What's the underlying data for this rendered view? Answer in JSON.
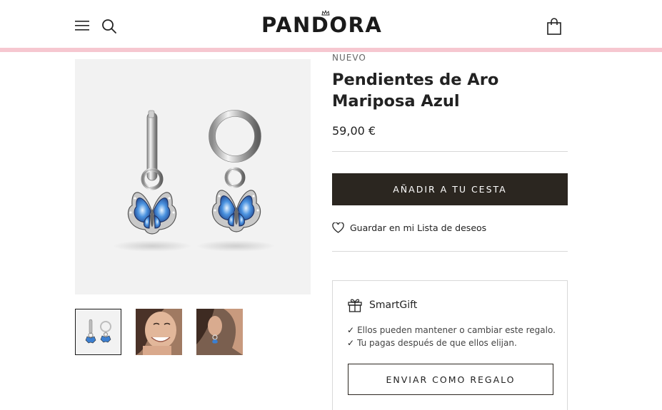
{
  "header": {
    "logo_text": "PANDORA",
    "menu_icon": "hamburger-menu-icon",
    "search_icon": "search-icon",
    "bag_icon": "shopping-bag-icon",
    "accent_color": "#f6c7d0"
  },
  "gallery": {
    "main_image": "blue-butterfly-hoop-earrings",
    "thumbnails": [
      {
        "name": "earrings-product-thumbnail",
        "selected": true
      },
      {
        "name": "smiling-model-thumbnail",
        "selected": false
      },
      {
        "name": "ear-wearing-earring-thumbnail",
        "selected": false
      }
    ]
  },
  "product": {
    "badge": "NUEVO",
    "title": "Pendientes de Aro Mariposa Azul",
    "price": "59,00 €",
    "add_to_cart_label": "AÑADIR A TU CESTA",
    "wishlist_label": "Guardar en mi Lista de deseos",
    "wishlist_icon": "heart-outline-icon"
  },
  "smartgift": {
    "icon": "gift-box-icon",
    "title": "SmartGift",
    "bullets": [
      "Ellos pueden mantener o cambiar este regalo.",
      "Tu pagas después de que ellos elijan."
    ],
    "check_mark": "✓",
    "button_label": "ENVIAR COMO REGALO"
  },
  "colors": {
    "primary_button": "#2b2620",
    "text": "#222222",
    "divider": "#d8d8d8",
    "enamel_blue": "#2f72c9"
  }
}
